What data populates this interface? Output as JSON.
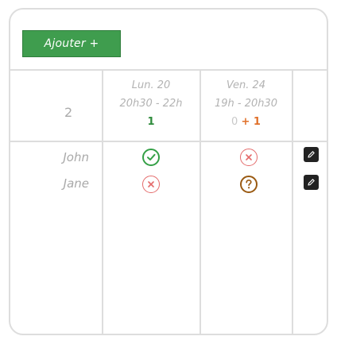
{
  "toolbar": {
    "add_label": "Ajouter +"
  },
  "participants_count": "2",
  "columns": [
    {
      "date": "Lun. 20",
      "time": "20h30 - 22h",
      "yes": "1",
      "zero": "",
      "maybe": ""
    },
    {
      "date": "Ven. 24",
      "time": "19h - 20h30",
      "yes": "",
      "zero": "0",
      "maybe": "+ 1"
    }
  ],
  "rows": [
    {
      "name": "John",
      "answers": [
        "yes-icon",
        "no-icon"
      ]
    },
    {
      "name": "Jane",
      "answers": [
        "no-icon",
        "maybe-icon"
      ]
    }
  ],
  "colors": {
    "accent": "#3f9d4e",
    "yes": "#34a046",
    "no": "#e46b6b",
    "maybe": "#9a5a12",
    "maybe_count": "#e0702a"
  },
  "icons": {
    "edit": "pencil-icon"
  }
}
